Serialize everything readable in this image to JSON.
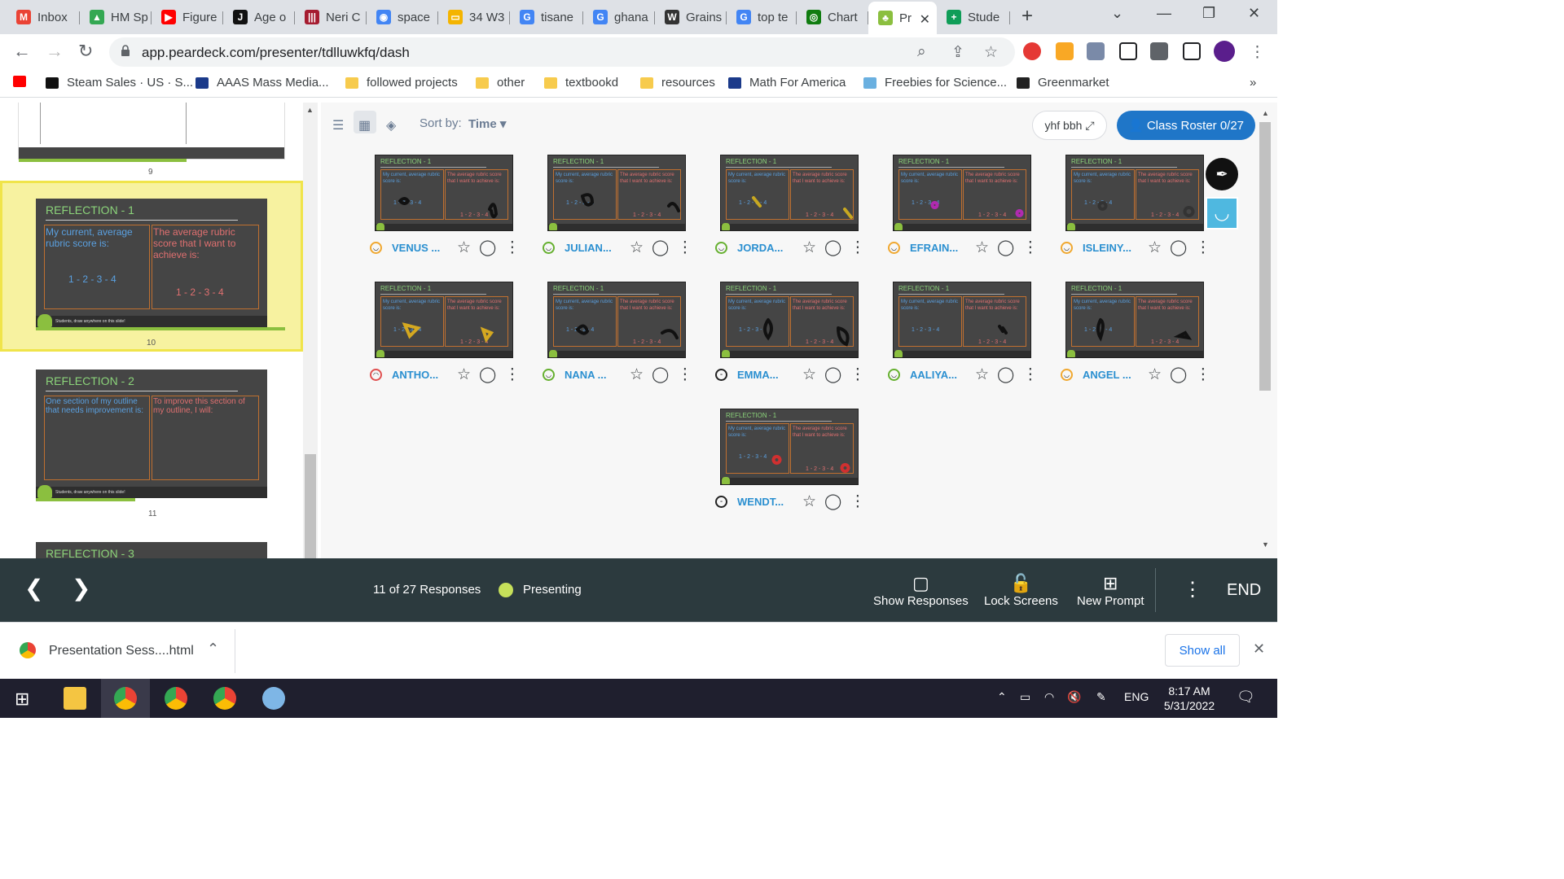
{
  "browser": {
    "tabs": [
      {
        "label": "Inbox",
        "icon": "gmail-icon",
        "color": "#ea4335",
        "glyph": "M"
      },
      {
        "label": "HM Sp",
        "icon": "drive-icon",
        "color": "#34a853",
        "glyph": "▲"
      },
      {
        "label": "Figure",
        "icon": "youtube-icon",
        "color": "#ff0000",
        "glyph": "▶"
      },
      {
        "label": "Age o",
        "icon": "jstor-icon",
        "color": "#111111",
        "glyph": "J"
      },
      {
        "label": "Neri C",
        "icon": "harvard-icon",
        "color": "#a51c30",
        "glyph": "|||"
      },
      {
        "label": "space",
        "icon": "chrome-icon",
        "color": "#4285f4",
        "glyph": "◉"
      },
      {
        "label": "34 W3",
        "icon": "slides-icon",
        "color": "#f4b400",
        "glyph": "▭"
      },
      {
        "label": "tisane",
        "icon": "google-icon",
        "color": "#4285f4",
        "glyph": "G"
      },
      {
        "label": "ghana",
        "icon": "google-icon",
        "color": "#4285f4",
        "glyph": "G"
      },
      {
        "label": "Grains",
        "icon": "wikipedia-icon",
        "color": "#333333",
        "glyph": "W"
      },
      {
        "label": "top te",
        "icon": "google-icon",
        "color": "#4285f4",
        "glyph": "G"
      },
      {
        "label": "Chart",
        "icon": "xbox-icon",
        "color": "#107c10",
        "glyph": "◎"
      },
      {
        "label": "Pr",
        "icon": "peardeck-icon",
        "color": "#8bbf3f",
        "glyph": "♣"
      },
      {
        "label": "Stude",
        "icon": "classroom-icon",
        "color": "#0f9d58",
        "glyph": "+"
      }
    ],
    "url": "app.peardeck.com/presenter/tdlluwkfq/dash",
    "bookmarks": [
      {
        "label": "",
        "icon": "youtube-icon"
      },
      {
        "label": "Steam Sales · US · S...",
        "icon": "steam-icon"
      },
      {
        "label": "AAAS Mass Media...",
        "icon": "aaas-icon"
      },
      {
        "label": "followed projects",
        "icon": "folder-icon"
      },
      {
        "label": "other",
        "icon": "folder-icon"
      },
      {
        "label": "textbookd",
        "icon": "folder-icon"
      },
      {
        "label": "resources",
        "icon": "folder-icon"
      },
      {
        "label": "Math For America",
        "icon": "mfa-icon"
      },
      {
        "label": "Freebies for Science...",
        "icon": "leaf-icon"
      },
      {
        "label": "Greenmarket",
        "icon": "greenmarket-icon"
      }
    ],
    "bookmarks_more": "»"
  },
  "slides": [
    {
      "number": "9"
    },
    {
      "number": "10",
      "title": "REFLECTION - 1",
      "left": "My current, average rubric score is:",
      "right": "The average rubric score that I want to achieve is:",
      "scaleL": "1 - 2 - 3 - 4",
      "scaleR": "1 - 2 - 3 - 4",
      "footer": "Students, draw anywhere on this slide!"
    },
    {
      "number": "11",
      "title": "REFLECTION - 2",
      "left": "One section of my outline that needs improvement is:",
      "right": "To improve this section of my outline, I will:",
      "footer": "Students, draw anywhere on this slide!"
    },
    {
      "title": "REFLECTION - 3"
    }
  ],
  "toolbar": {
    "sort_label": "Sort by:",
    "sort_value": "Time",
    "project_button": "yhf bbh",
    "roster_button": "Class Roster 0/27"
  },
  "mini_slide": {
    "title": "REFLECTION - 1",
    "left": "My current, average rubric score is:",
    "right": "The average rubric score that I want to achieve is:",
    "scale": "1 - 2 - 3 - 4"
  },
  "responses": [
    {
      "name": "VENUS ...",
      "mood": "orange"
    },
    {
      "name": "JULIAN...",
      "mood": "green"
    },
    {
      "name": "JORDA...",
      "mood": "green"
    },
    {
      "name": "EFRAIN...",
      "mood": "orange"
    },
    {
      "name": "ISLEINY...",
      "mood": "orange"
    },
    {
      "name": "ANTHO...",
      "mood": "red"
    },
    {
      "name": "NANA ...",
      "mood": "green"
    },
    {
      "name": "EMMA...",
      "mood": "black"
    },
    {
      "name": "AALIYA...",
      "mood": "green"
    },
    {
      "name": "ANGEL ...",
      "mood": "orange"
    },
    {
      "name": "WENDT...",
      "mood": "black"
    }
  ],
  "bottom": {
    "responses": "11 of 27 Responses",
    "status": "Presenting",
    "show_responses": "Show Responses",
    "lock_screens": "Lock Screens",
    "new_prompt": "New Prompt",
    "end": "END"
  },
  "download": {
    "file": "Presentation Sess....html",
    "show_all": "Show all"
  },
  "taskbar": {
    "lang": "ENG",
    "time": "8:17 AM",
    "date": "5/31/2022"
  }
}
